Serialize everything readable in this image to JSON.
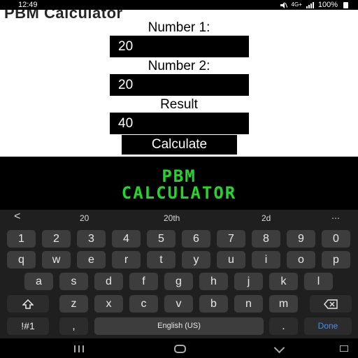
{
  "status_bar": {
    "time": "12:49",
    "network": "4G+",
    "battery_pct": "100%"
  },
  "app": {
    "title": "PBM Calculator",
    "number1_label": "Number 1:",
    "number1_value": "20",
    "number2_label": "Number 2:",
    "number2_value": "20",
    "result_label": "Result",
    "result_value": "40",
    "calculate_label": "Calculate"
  },
  "banner": {
    "line1": "PBM",
    "line2": "CALCULATOR"
  },
  "keyboard": {
    "suggestions": [
      "<",
      "20",
      "20th",
      "2d",
      "⋯"
    ],
    "row_numbers": [
      "1",
      "2",
      "3",
      "4",
      "5",
      "6",
      "7",
      "8",
      "9",
      "0"
    ],
    "row1": [
      "q",
      "w",
      "e",
      "r",
      "t",
      "y",
      "u",
      "i",
      "o",
      "p"
    ],
    "row2": [
      "a",
      "s",
      "d",
      "f",
      "g",
      "h",
      "j",
      "k",
      "l"
    ],
    "row3": [
      "z",
      "x",
      "c",
      "v",
      "b",
      "n",
      "m"
    ],
    "symbols_label": "!#1",
    "comma": ",",
    "space_label": "English (US)",
    "period": ".",
    "done_label": "Done",
    "done_color": "#4a8ef0"
  },
  "colors": {
    "accent_green": "#21d82a"
  }
}
